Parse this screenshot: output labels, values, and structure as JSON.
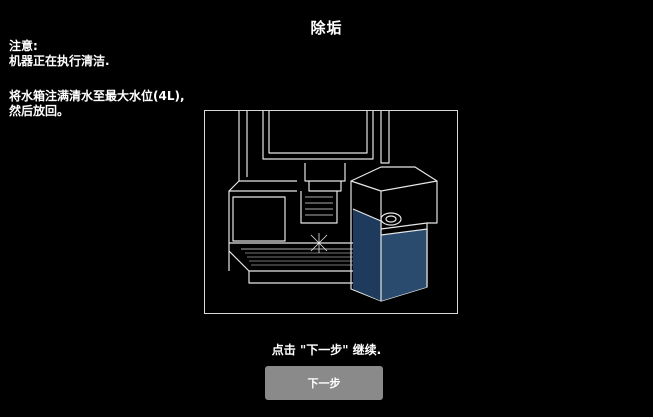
{
  "screen": {
    "title": "除垢",
    "notice": {
      "heading": "注意:",
      "line": "机器正在执行清洁."
    },
    "instruction": {
      "line1": "将水箱注满清水至最大水位(4L),",
      "line2": "然后放回。"
    },
    "illustration": {
      "subject": "coffee-machine-water-tank",
      "highlight_color": "#1e3a5c",
      "line_color": "#e6e6e6"
    },
    "hint": "点击 \"下一步\" 继续.",
    "next_button_label": "下一步",
    "colors": {
      "background": "#000000",
      "text": "#ffffff",
      "button": "#8a8a8a"
    }
  }
}
